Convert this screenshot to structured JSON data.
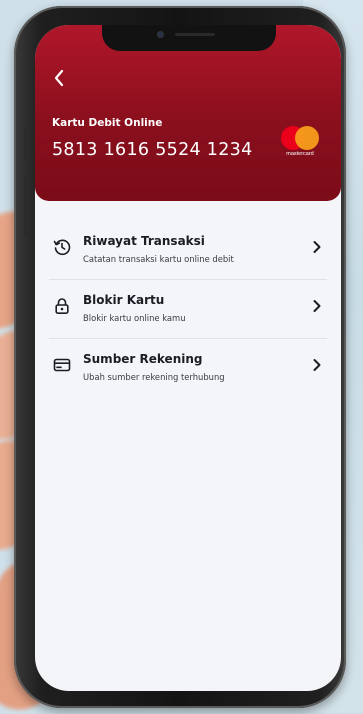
{
  "header": {
    "back_icon": "chevron-left-icon",
    "card_label": "Kartu Debit Online",
    "card_number": "5813 1616 5524 1234",
    "card_brand": "mastercard",
    "colors": {
      "header_red": "#9b1322",
      "mastercard_red": "#eb001b",
      "mastercard_yellow": "#f79e1b"
    }
  },
  "menu": {
    "items": [
      {
        "icon": "history-icon",
        "title": "Riwayat Transaksi",
        "subtitle": "Catatan transaksi kartu online debit"
      },
      {
        "icon": "lock-icon",
        "title": "Blokir Kartu",
        "subtitle": "Blokir kartu online kamu"
      },
      {
        "icon": "card-icon",
        "title": "Sumber Rekening",
        "subtitle": "Ubah sumber rekening terhubung"
      }
    ]
  }
}
